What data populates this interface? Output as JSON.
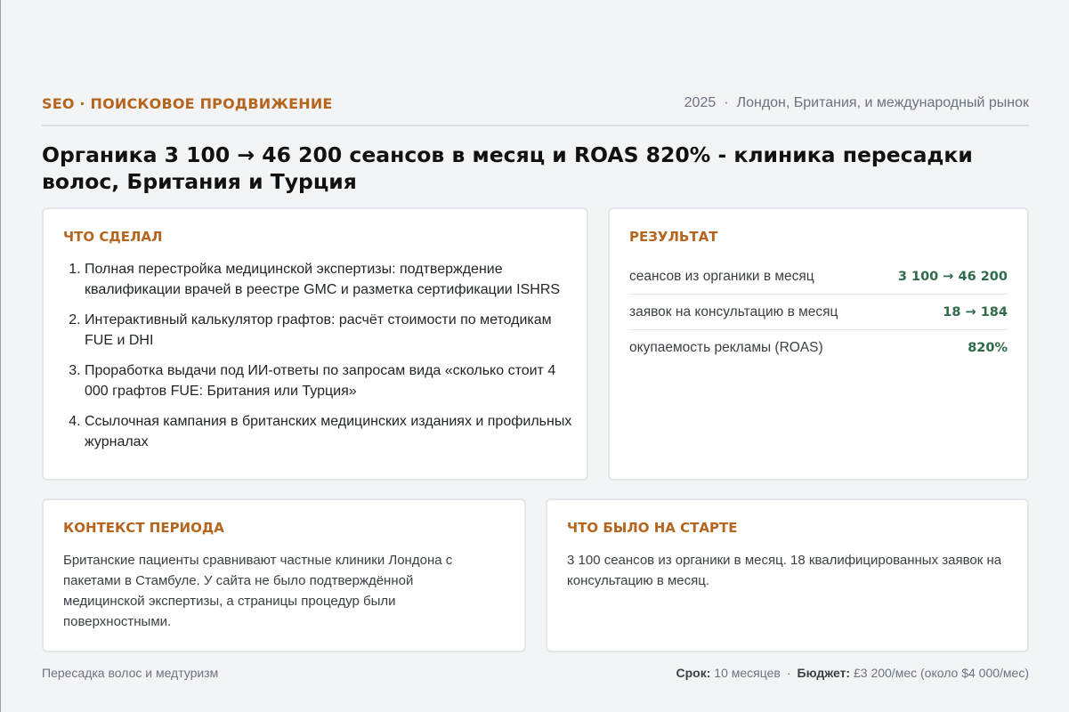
{
  "header": {
    "tag": "SEO · ПОИСКОВОЕ ПРОДВИЖЕНИЕ",
    "year": "2025",
    "separator": "·",
    "location": "Лондон, Британия, и международный рынок"
  },
  "title": "Органика 3 100 → 46 200 сеансов в месяц и ROAS 820% - клиника пересадки волос, Британия и Турция",
  "did": {
    "heading": "ЧТО СДЕЛАЛ",
    "items": [
      "Полная перестройка медицинской экспертизы: подтверждение квалификации врачей в реестре GMC и разметка сертификации ISHRS",
      "Интерактивный калькулятор графтов: расчёт стоимости по методикам FUE и DHI",
      "Проработка выдачи под ИИ-ответы по запросам вида «сколько стоит 4 000 графтов FUE: Британия или Турция»",
      "Ссылочная кампания в британских медицинских изданиях и профильных журналах"
    ]
  },
  "result": {
    "heading": "РЕЗУЛЬТАТ",
    "rows": [
      {
        "label": "сеансов из органики в месяц",
        "value": "3 100 → 46 200"
      },
      {
        "label": "заявок на консультацию в месяц",
        "value": "18 → 184"
      },
      {
        "label": "окупаемость рекламы (ROAS)",
        "value": "820%"
      }
    ]
  },
  "context": {
    "heading": "КОНТЕКСТ ПЕРИОДА",
    "text": "Британские пациенты сравнивают частные клиники Лондона с пакетами в Стамбуле. У сайта не было подтверждённой медицинской экспертизы, а страницы процедур были поверхностными."
  },
  "start": {
    "heading": "ЧТО БЫЛО НА СТАРТЕ",
    "text": "3 100 сеансов из органики в месяц. 18 квалифицированных заявок на консультацию в месяц."
  },
  "footer": {
    "niche": "Пересадка волос и медтуризм",
    "term_label": "Срок:",
    "term_value": "10 месяцев",
    "separator": "·",
    "budget_label": "Бюджет:",
    "budget_value": "£3 200/мес (около $4 000/мес)"
  },
  "colors": {
    "accent": "#b5651d",
    "result_value": "#2e6b4a",
    "background": "#f3f4f6"
  }
}
